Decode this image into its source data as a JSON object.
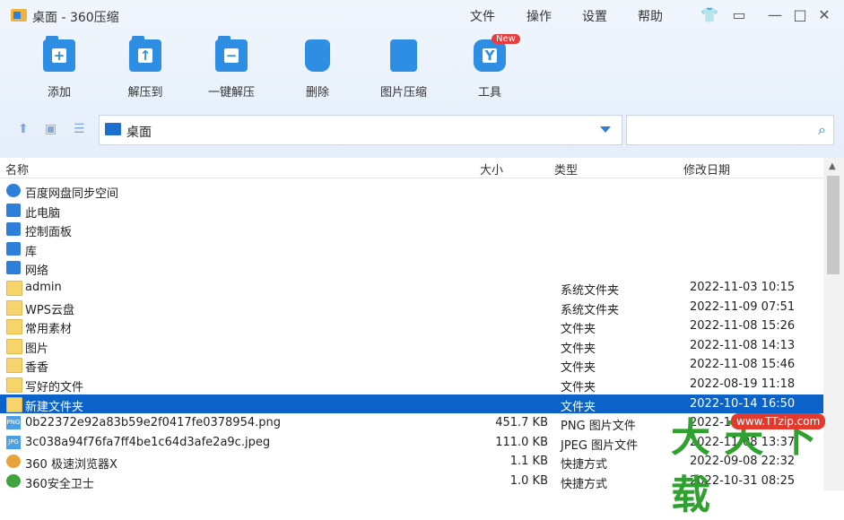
{
  "title": "桌面 - 360压缩",
  "menu": [
    "文件",
    "操作",
    "设置",
    "帮助"
  ],
  "window_controls": [
    "shirt-icon",
    "message-icon",
    "minimize-icon",
    "maximize-icon",
    "close-icon"
  ],
  "toolbar": [
    {
      "label": "添加",
      "icon": "add-folder-icon"
    },
    {
      "label": "解压到",
      "icon": "extract-to-icon"
    },
    {
      "label": "一键解压",
      "icon": "one-click-extract-icon"
    },
    {
      "label": "删除",
      "icon": "recycle-bin-icon"
    },
    {
      "label": "图片压缩",
      "icon": "image-compress-icon"
    },
    {
      "label": "工具",
      "icon": "tools-icon",
      "badge": "New"
    }
  ],
  "address": {
    "path": "桌面",
    "search_placeholder": ""
  },
  "columns": {
    "name": "名称",
    "size": "大小",
    "type": "类型",
    "date": "修改日期"
  },
  "files": [
    {
      "name": "百度网盘同步空间",
      "size": "",
      "type": "",
      "date": "",
      "icon": "sync-icon"
    },
    {
      "name": "此电脑",
      "size": "",
      "type": "",
      "date": "",
      "icon": "computer-icon"
    },
    {
      "name": "控制面板",
      "size": "",
      "type": "",
      "date": "",
      "icon": "control-panel-icon"
    },
    {
      "name": "库",
      "size": "",
      "type": "",
      "date": "",
      "icon": "library-icon"
    },
    {
      "name": "网络",
      "size": "",
      "type": "",
      "date": "",
      "icon": "network-icon"
    },
    {
      "name": "admin",
      "size": "",
      "type": "系统文件夹",
      "date": "2022-11-03 10:15",
      "icon": "folder-icon"
    },
    {
      "name": "WPS云盘",
      "size": "",
      "type": "系统文件夹",
      "date": "2022-11-09 07:51",
      "icon": "folder-icon"
    },
    {
      "name": "常用素材",
      "size": "",
      "type": "文件夹",
      "date": "2022-11-08 15:26",
      "icon": "folder-icon"
    },
    {
      "name": "图片",
      "size": "",
      "type": "文件夹",
      "date": "2022-11-08 14:13",
      "icon": "folder-icon"
    },
    {
      "name": "香香",
      "size": "",
      "type": "文件夹",
      "date": "2022-11-08 15:46",
      "icon": "folder-icon"
    },
    {
      "name": "写好的文件",
      "size": "",
      "type": "文件夹",
      "date": "2022-08-19 11:18",
      "icon": "folder-icon"
    },
    {
      "name": "新建文件夹",
      "size": "",
      "type": "文件夹",
      "date": "2022-10-14 16:50",
      "icon": "folder-icon",
      "selected": true
    },
    {
      "name": "0b22372e92a83b59e2f0417fe0378954.png",
      "size": "451.7 KB",
      "type": "PNG 图片文件",
      "date": "2022-11-08 14:09",
      "icon": "png-file-icon"
    },
    {
      "name": "3c038a94f76fa7ff4be1c64d3afe2a9c.jpeg",
      "size": "111.0 KB",
      "type": "JPEG 图片文件",
      "date": "2022-11-08 13:37",
      "icon": "jpeg-file-icon"
    },
    {
      "name": "360 极速浏览器X",
      "size": "1.1 KB",
      "type": "快捷方式",
      "date": "2022-09-08 22:32",
      "icon": "browser-icon"
    },
    {
      "name": "360安全卫士",
      "size": "1.0 KB",
      "type": "快捷方式",
      "date": "2022-10-31 08:25",
      "icon": "security-icon"
    }
  ],
  "watermark": {
    "main": "大 天 下载",
    "tag": "www.TTzip.com"
  }
}
